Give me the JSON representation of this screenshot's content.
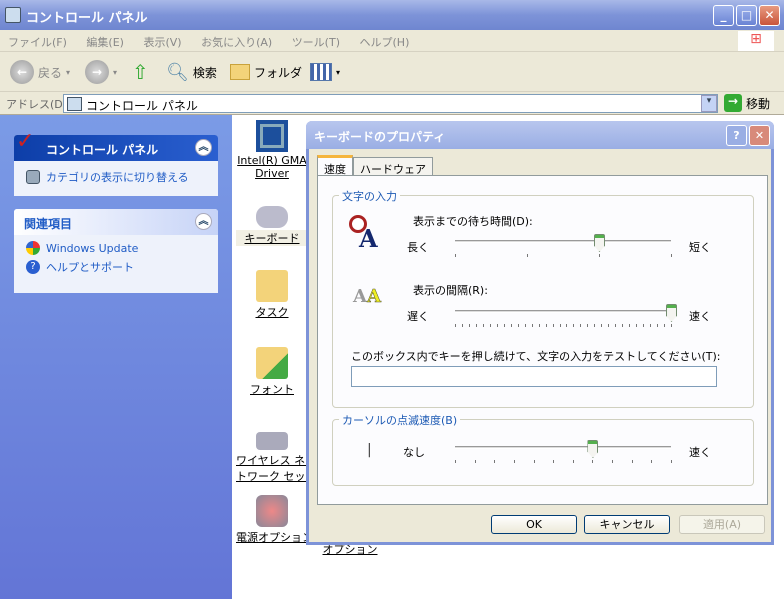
{
  "window": {
    "title": "コントロール パネル"
  },
  "menu": [
    "ファイル(F)",
    "編集(E)",
    "表示(V)",
    "お気に入り(A)",
    "ツール(T)",
    "ヘルプ(H)"
  ],
  "toolbar": {
    "back": "戻る",
    "search": "検索",
    "folders": "フォルダ"
  },
  "address": {
    "label": "アドレス(D)",
    "value": "コントロール パネル",
    "go": "移動"
  },
  "sidebar": {
    "panel1": {
      "title": "コントロール パネル",
      "links": [
        "カテゴリの表示に切り替える"
      ]
    },
    "panel2": {
      "title": "関連項目",
      "links": [
        "Windows Update",
        "ヘルプとサポート"
      ]
    }
  },
  "items": [
    {
      "label1": "Intel(R) GMA",
      "label2": "Driver"
    },
    {
      "label1": "キーボード"
    },
    {
      "label1": "タスク"
    },
    {
      "label1": "フォント"
    },
    {
      "label1": "ワイヤレス ネッ",
      "label2": "トワーク セット..."
    },
    {
      "label1": "電源オプション"
    },
    {
      "label1": "オプション"
    }
  ],
  "dialog": {
    "title": "キーボードのプロパティ",
    "tabs": [
      "速度",
      "ハードウェア"
    ],
    "active_tab": "速度",
    "group1": {
      "title": "文字の入力",
      "delay": {
        "label": "表示までの待ち時間(D):",
        "min_label": "長く",
        "max_label": "短く",
        "value": 2,
        "max": 3
      },
      "rate": {
        "label": "表示の間隔(R):",
        "min_label": "遅く",
        "max_label": "速く",
        "value": 31,
        "max": 31
      },
      "test_label": "このボックス内でキーを押し続けて、文字の入力をテストしてください(T):",
      "test_value": ""
    },
    "group2": {
      "title": "カーソルの点滅速度(B)",
      "cursor_glyph": "|",
      "min_label": "なし",
      "max_label": "速く",
      "value": 7,
      "max": 11
    },
    "buttons": {
      "ok": "OK",
      "cancel": "キャンセル",
      "apply": "適用(A)"
    }
  },
  "colors": {
    "accent": "#7d93d8",
    "slider_thumb": "#54b04d"
  }
}
